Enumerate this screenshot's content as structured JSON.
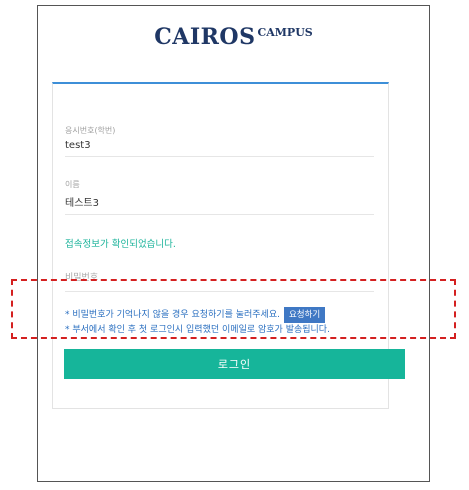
{
  "logo": {
    "main": "CAIROS",
    "sub": "CAMPUS"
  },
  "form": {
    "exam_number_label": "응시번호(학번)",
    "exam_number_value": "test3",
    "name_label": "이름",
    "name_value": "테스트3",
    "confirm_message": "접속정보가 확인되었습니다.",
    "password_placeholder": "비밀번호",
    "note_forgot": "* 비밀번호가 기억나지 않을 경우 요청하기를 눌러주세요.",
    "request_button": "요청하기",
    "note_email": "* 부서에서 확인 후 첫 로그인시 입력했던 이메일로 암호가 발송됩니다.",
    "login_button": "로그인"
  },
  "colors": {
    "brand": "#1f3765",
    "accent_line": "#3d8fd8",
    "success_text": "#1ab39a",
    "info_text": "#2a6fc0",
    "login_button": "#16b59a",
    "highlight_border": "#d42020"
  }
}
